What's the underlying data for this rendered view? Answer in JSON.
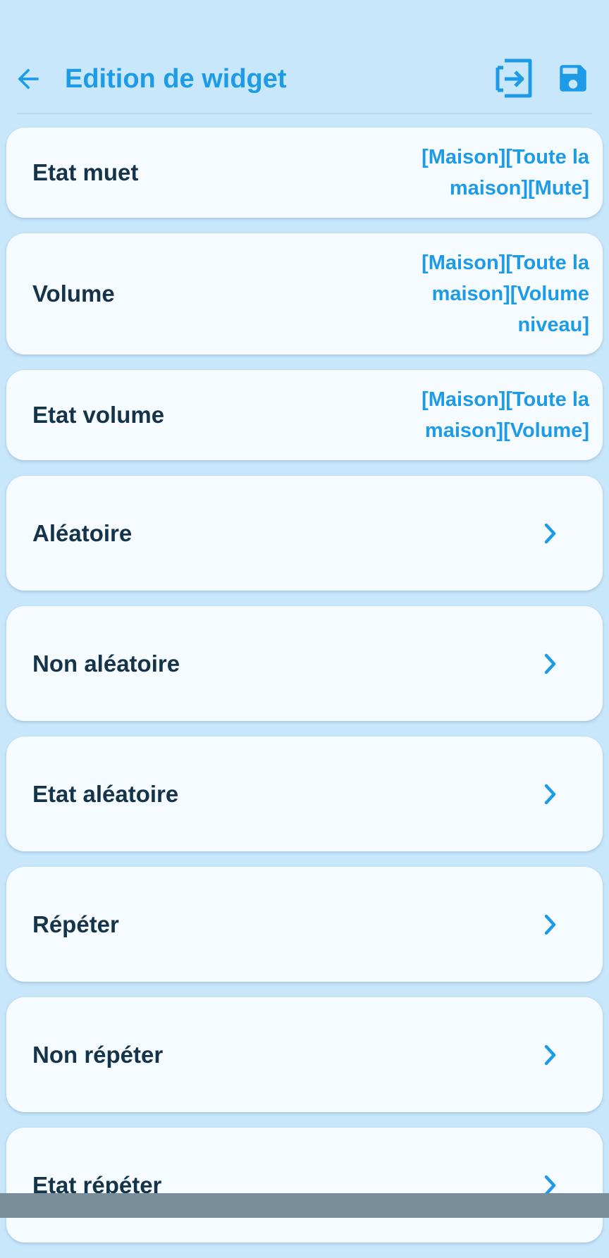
{
  "app_bar": {
    "title": "Edition de widget",
    "back_icon": "arrow-left-icon",
    "import_icon": "import-icon",
    "save_icon": "floppy-disk-icon"
  },
  "colors": {
    "background": "#c9e7fb",
    "accent": "#1e9be6",
    "card": "#f6fbff",
    "label": "#15344a"
  },
  "items": [
    {
      "label": "Etat muet",
      "value": "[Maison][Toute la maison][Mute]"
    },
    {
      "label": "Volume",
      "value": "[Maison][Toute la maison][Volume niveau]"
    },
    {
      "label": "Etat volume",
      "value": "[Maison][Toute la maison][Volume]"
    },
    {
      "label": "Aléatoire",
      "chevron": "chevron-right-icon"
    },
    {
      "label": "Non aléatoire",
      "chevron": "chevron-right-icon"
    },
    {
      "label": "Etat aléatoire",
      "chevron": "chevron-right-icon"
    },
    {
      "label": "Répéter",
      "chevron": "chevron-right-icon"
    },
    {
      "label": "Non répéter",
      "chevron": "chevron-right-icon"
    },
    {
      "label": "Etat répéter",
      "chevron": "chevron-right-icon"
    }
  ]
}
